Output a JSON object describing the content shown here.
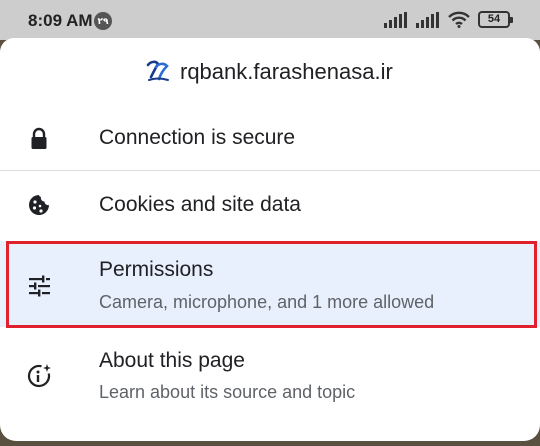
{
  "status_bar": {
    "time": "8:09 AM",
    "notification_badge": "۲۹",
    "battery_level": "54",
    "icons": [
      "signal-bars-icon",
      "signal-bars-icon",
      "wifi-icon",
      "battery-icon"
    ]
  },
  "site": {
    "url": "rqbank.farashenasa.ir",
    "favicon": "site-logo-icon"
  },
  "menu": {
    "connection": {
      "title": "Connection is secure",
      "icon": "lock-icon"
    },
    "cookies": {
      "title": "Cookies and site data",
      "icon": "cookie-icon"
    },
    "permissions": {
      "title": "Permissions",
      "subtitle": "Camera, microphone, and 1 more allowed",
      "icon": "tune-sliders-icon"
    },
    "about": {
      "title": "About this page",
      "subtitle": "Learn about its source and topic",
      "icon": "info-sparkle-icon"
    }
  },
  "colors": {
    "highlight_border": "#e0202c",
    "selected_row_bg": "#e8f0fe",
    "text_primary": "#202124",
    "text_secondary": "#5f6368"
  }
}
